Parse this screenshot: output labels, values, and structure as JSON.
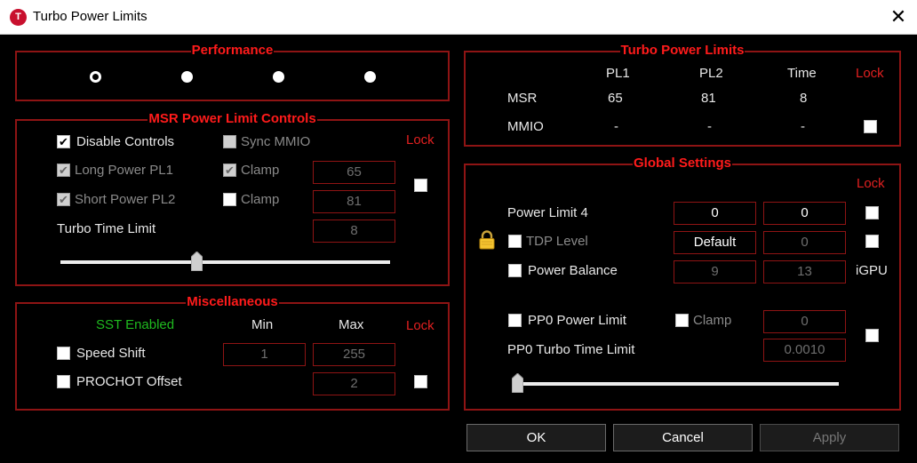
{
  "window": {
    "title": "Turbo Power Limits",
    "close_glyph": "✕",
    "app_icon_letter": "T"
  },
  "check_mark": "✔",
  "performance": {
    "title": "Performance",
    "selected_index": 0,
    "options_count": 4
  },
  "msr": {
    "title": "MSR Power Limit Controls",
    "disable_controls": "Disable Controls",
    "sync_mmio": "Sync MMIO",
    "lock": "Lock",
    "long_power": "Long Power PL1",
    "short_power": "Short Power PL2",
    "clamp": "Clamp",
    "turbo_time": "Turbo Time Limit",
    "pl1_value": "65",
    "pl2_value": "81",
    "time_value": "8",
    "slider_fraction": 0.41
  },
  "misc": {
    "title": "Miscellaneous",
    "sst": "SST Enabled",
    "min": "Min",
    "max": "Max",
    "lock": "Lock",
    "speed_shift": "Speed Shift",
    "prochot": "PROCHOT Offset",
    "speed_min": "1",
    "speed_max": "255",
    "prochot_value": "2"
  },
  "tpl": {
    "title": "Turbo Power Limits",
    "col_pl1": "PL1",
    "col_pl2": "PL2",
    "col_time": "Time",
    "lock": "Lock",
    "msr_label": "MSR",
    "msr_pl1": "65",
    "msr_pl2": "81",
    "msr_time": "8",
    "mmio_label": "MMIO",
    "mmio_pl1": "-",
    "mmio_pl2": "-",
    "mmio_time": "-"
  },
  "global": {
    "title": "Global Settings",
    "lock": "Lock",
    "power_limit_4": "Power Limit 4",
    "pl4_a": "0",
    "pl4_b": "0",
    "tdp_level": "TDP Level",
    "tdp_value": "Default",
    "tdp_b": "0",
    "power_balance": "Power Balance",
    "pb_a": "9",
    "pb_b": "13",
    "igpu": "iGPU",
    "pp0_limit": "PP0 Power Limit",
    "clamp": "Clamp",
    "pp0_value": "0",
    "pp0_time": "PP0 Turbo Time Limit",
    "pp0_time_value": "0.0010",
    "slider_fraction": 0.0
  },
  "buttons": {
    "ok": "OK",
    "cancel": "Cancel",
    "apply": "Apply"
  },
  "icons": {
    "lock": "padlock-icon",
    "close": "close-icon"
  },
  "colors": {
    "accent_red": "#ff1b1b",
    "frame_red": "#8e1414",
    "sst_green": "#1fba1f"
  }
}
